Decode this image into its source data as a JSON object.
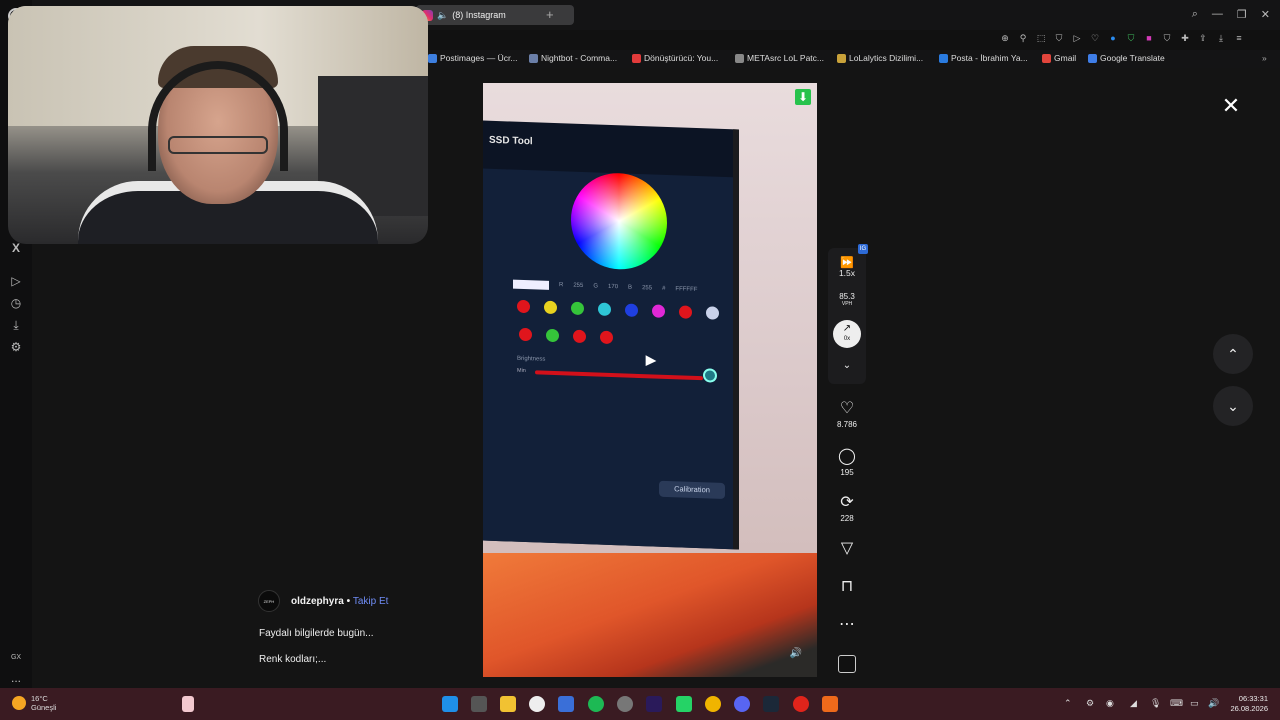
{
  "browser": {
    "tab_title": "(8) Instagram",
    "new_tab": "+",
    "window_controls": [
      "⌕",
      "—",
      "❐",
      "✕"
    ],
    "rail_labels": [
      "GX",
      "..."
    ]
  },
  "bookmarks": [
    {
      "label": "Postimages — Ücr...",
      "color": "#3d7fe0"
    },
    {
      "label": "Nightbot - Comma...",
      "color": "#6b7fa8"
    },
    {
      "label": "Dönüştürücü: You...",
      "color": "#e23b3b"
    },
    {
      "label": "METAsrc LoL Patc...",
      "color": "#888888"
    },
    {
      "label": "LoLalytics Dizilimi...",
      "color": "#c9a23a"
    },
    {
      "label": "Posta - İbrahim Ya...",
      "color": "#2a7be0"
    },
    {
      "label": "Gmail",
      "color": "#e2453c"
    },
    {
      "label": "Google Translate",
      "color": "#3f7ee8"
    }
  ],
  "reel": {
    "app_title": "SSD Tool",
    "rgb": {
      "r_label": "R",
      "r": "255",
      "g_label": "G",
      "g": "170",
      "b_label": "B",
      "b": "255",
      "hex_label": "#",
      "hex": "FFFFFF"
    },
    "brightness_label": "Brightness",
    "min_label": "Min",
    "calibration": "Calibration",
    "swatches_row1": [
      "#e0151c",
      "#e8d21f",
      "#35c43a",
      "#2ec6d6",
      "#1f3fe0",
      "#e028d6",
      "#e0151c",
      "#c9d2ea"
    ],
    "swatches_row2": [
      "#e0151c",
      "#35c43a",
      "#e0151c",
      "#e0151c"
    ]
  },
  "actions": {
    "speed": "1.5x",
    "speed_tag": "IG",
    "vph_value": "85.3",
    "vph_label": "VPH",
    "trend": "0x",
    "likes": "8.786",
    "comments": "195",
    "reposts": "228"
  },
  "caption": {
    "avatar_text": "ZEPH",
    "username": "oldzephyra",
    "separator": " • ",
    "follow": "Takip Et",
    "line1": "Faydalı bilgilerde bugün...",
    "line2": "Renk kodları;..."
  },
  "taskbar": {
    "temp": "16°C",
    "condition": "Güneşli",
    "time": "06:33:31",
    "date": "26.08.2026"
  }
}
